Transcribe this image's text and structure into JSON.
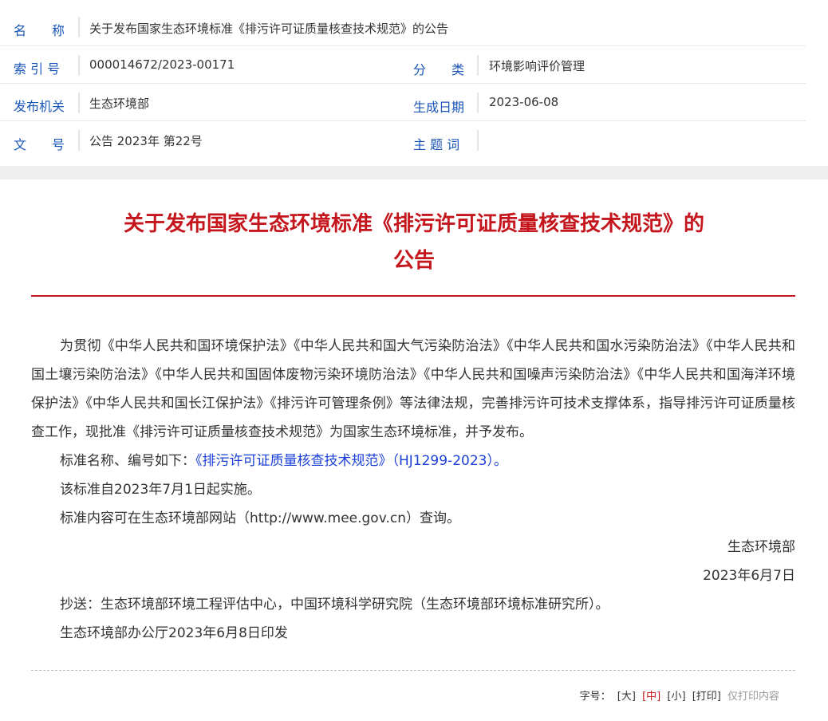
{
  "meta": {
    "rows": [
      {
        "label": "名　　称",
        "value": "关于发布国家生态环境标准《排污许可证质量核查技术规范》的公告"
      },
      {
        "label": "索 引 号",
        "value": "000014672/2023-00171",
        "label2": "分　　类",
        "value2": "环境影响评价管理"
      },
      {
        "label": "发布机关",
        "value": "生态环境部",
        "label2": "生成日期",
        "value2": "2023-06-08"
      },
      {
        "label": "文　　号",
        "value": "公告 2023年 第22号",
        "label2": "主 题 词",
        "value2": ""
      }
    ]
  },
  "article": {
    "title_line1": "关于发布国家生态环境标准《排污许可证质量核查技术规范》的",
    "title_line2": "公告",
    "para1": "为贯彻《中华人民共和国环境保护法》《中华人民共和国大气污染防治法》《中华人民共和国水污染防治法》《中华人民共和国土壤污染防治法》《中华人民共和国固体废物污染环境防治法》《中华人民共和国噪声污染防治法》《中华人民共和国海洋环境保护法》《中华人民共和国长江保护法》《排污许可管理条例》等法律法规，完善排污许可技术支撑体系，指导排污许可证质量核查工作，现批准《排污许可证质量核查技术规范》为国家生态环境标准，并予发布。",
    "standard_prefix": "标准名称、编号如下：",
    "standard_link": "《排污许可证质量核查技术规范》（HJ1299-2023）",
    "standard_suffix": "。",
    "effective": "该标准自2023年7月1日起实施。",
    "content_note": "标准内容可在生态环境部网站（http://www.mee.gov.cn）查询。",
    "signer": "生态环境部",
    "sign_date": "2023年6月7日",
    "cc": "抄送：生态环境部环境工程评估中心，中国环境科学研究院（生态环境部环境标准研究所）。",
    "issued": "生态环境部办公厅2023年6月8日印发"
  },
  "footer": {
    "font_label": "字号：",
    "large": "[大]",
    "medium": "[中]",
    "small": "[小]",
    "print": "[打印]",
    "print_only": "仅打印内容"
  },
  "colors": {
    "title_red": "#c4161c",
    "label_blue": "#1a56b8",
    "link_blue": "#1a3fd8"
  }
}
